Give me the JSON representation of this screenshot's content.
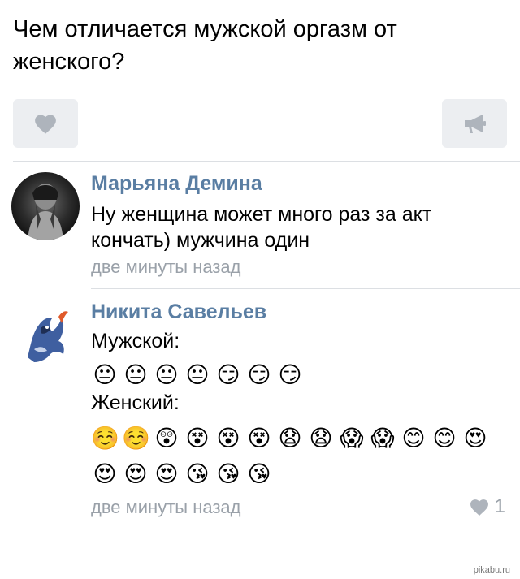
{
  "post": {
    "question": "Чем отличается мужской оргазм от женского?",
    "like_icon": "heart-icon",
    "share_icon": "megaphone-icon"
  },
  "comments": [
    {
      "author": "Марьяна Демина",
      "text": "Ну женщина может много раз за акт кончать) мужчина один",
      "time": "две минуты назад",
      "avatar": "bw-portrait-avatar"
    },
    {
      "author": "Никита Савельев",
      "male_label": "Мужской:",
      "male_emoji": [
        "😐",
        "😐",
        "😐",
        "😐",
        "😏",
        "😏",
        "😏"
      ],
      "female_label": "Женский:",
      "female_emoji_row1": [
        "☺️",
        "☺️",
        "😲",
        "😵",
        "😵",
        "😵",
        "😧",
        "😧",
        "😱",
        "😱",
        "😊",
        "😊",
        "😍"
      ],
      "female_emoji_row2": [
        "😍",
        "😍",
        "😍",
        "😘",
        "😘",
        "😘"
      ],
      "time": "две минуты назад",
      "like_count": "1",
      "avatar": "wolf-art-avatar"
    }
  ],
  "watermark": "pikabu.ru",
  "colors": {
    "author": "#5a7ea3",
    "meta": "#9aa1a9",
    "button_bg": "#eceef1",
    "icon": "#aeb4bc"
  }
}
